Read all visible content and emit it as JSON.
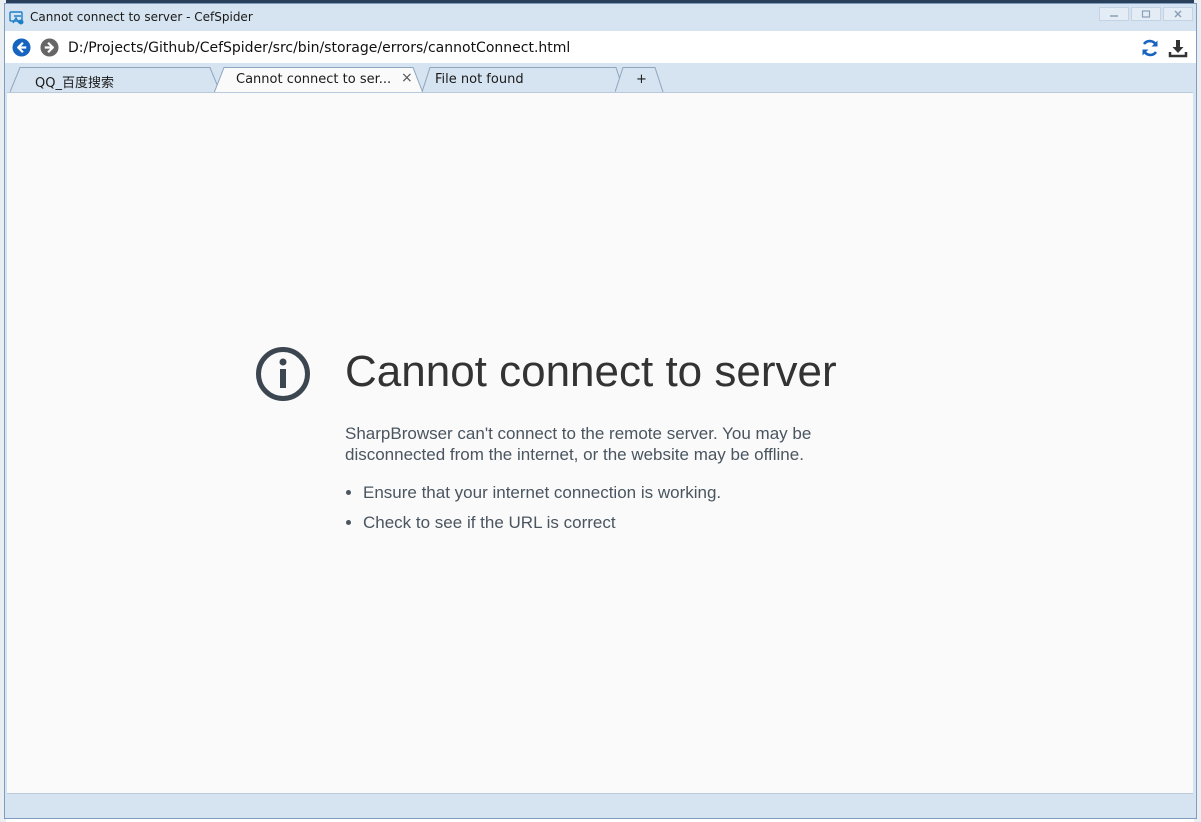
{
  "window": {
    "title": "Cannot connect to server - CefSpider",
    "controls": [
      "minimize",
      "maximize",
      "close"
    ]
  },
  "address_bar": {
    "url": "D:/Projects/Github/CefSpider/src/bin/storage/errors/cannotConnect.html",
    "back_icon": "back-arrow-icon",
    "forward_icon": "forward-arrow-icon",
    "refresh_icon": "refresh-icon",
    "download_icon": "download-icon"
  },
  "tabs": [
    {
      "label": "QQ_百度搜索",
      "active": false
    },
    {
      "label": "Cannot  connect  to  ser...",
      "active": true,
      "close": "×"
    },
    {
      "label": "File not found",
      "active": false
    },
    {
      "label": "+",
      "active": false
    }
  ],
  "error_page": {
    "icon": "info-icon",
    "title": "Cannot connect to server",
    "description": "SharpBrowser can't connect to the remote server. You may be disconnected from the internet, or the website may be offline.",
    "tips": [
      "Ensure that your internet connection is working.",
      "Check to see if the URL is correct"
    ]
  },
  "colors": {
    "chrome": "#d6e3f0",
    "nav_blue": "#1664c0",
    "nav_gray": "#666666",
    "icon_dark": "#3c4650"
  }
}
